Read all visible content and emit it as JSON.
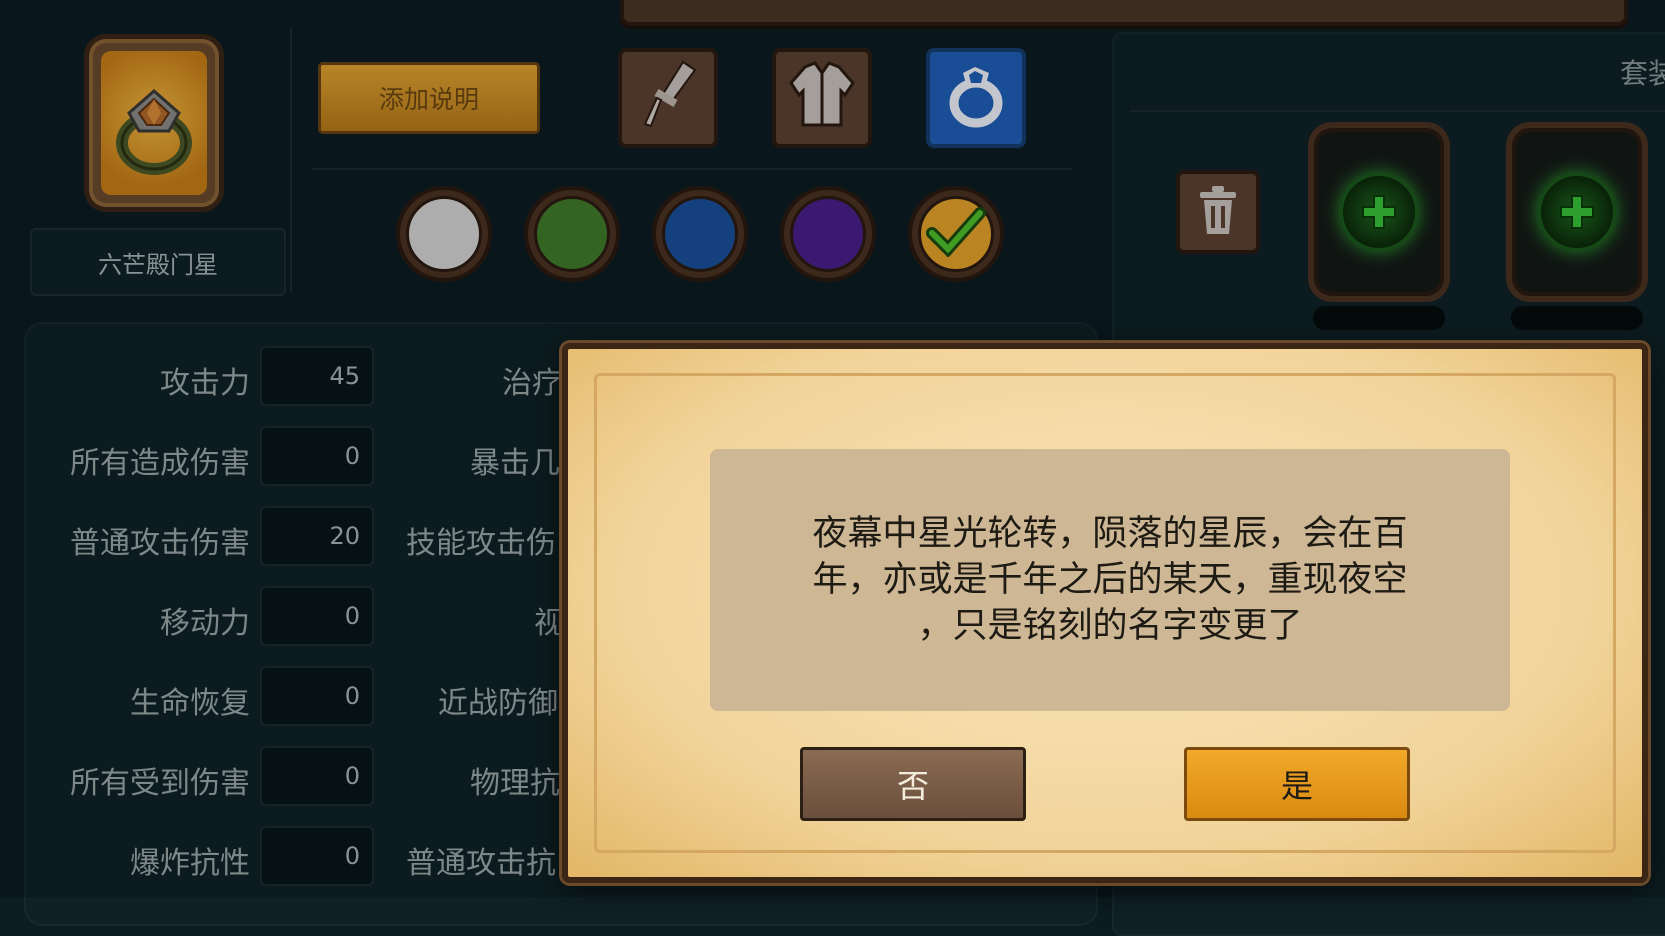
{
  "item": {
    "name": "六芒殿门星",
    "icon": "ring-icon"
  },
  "toolbar": {
    "add_note_label": "添加说明",
    "categories": [
      {
        "name": "weapon",
        "icon": "sword-icon"
      },
      {
        "name": "armor",
        "icon": "armor-icon"
      },
      {
        "name": "accessory",
        "icon": "ring-icon",
        "selected": true
      }
    ]
  },
  "colors": [
    {
      "name": "white",
      "hex": "#d3d3d3"
    },
    {
      "name": "green",
      "hex": "#3f7a2a"
    },
    {
      "name": "blue",
      "hex": "#1a4f9a"
    },
    {
      "name": "purple",
      "hex": "#4a1f8a"
    },
    {
      "name": "gold",
      "hex": "#e3a12a",
      "selected": true
    }
  ],
  "stats_left": [
    {
      "label": "攻击力",
      "value": "45"
    },
    {
      "label": "所有造成伤害",
      "value": "0"
    },
    {
      "label": "普通攻击伤害",
      "value": "20"
    },
    {
      "label": "移动力",
      "value": "0"
    },
    {
      "label": "生命恢复",
      "value": "0"
    },
    {
      "label": "所有受到伤害",
      "value": "0"
    },
    {
      "label": "爆炸抗性",
      "value": "0"
    }
  ],
  "stats_right_partial": [
    {
      "label": "治疗"
    },
    {
      "label": "暴击几"
    },
    {
      "label": "技能攻击伤"
    },
    {
      "label": "视"
    },
    {
      "label": "近战防御"
    },
    {
      "label": "物理抗"
    },
    {
      "label": "普通攻击抗"
    }
  ],
  "set_panel": {
    "title": "套装"
  },
  "dialog": {
    "message": "夜幕中星光轮转，陨落的星辰，会在百\n年，亦或是千年之后的某天，重现夜空\n，只是铭刻的名字变更了",
    "no_label": "否",
    "yes_label": "是"
  }
}
